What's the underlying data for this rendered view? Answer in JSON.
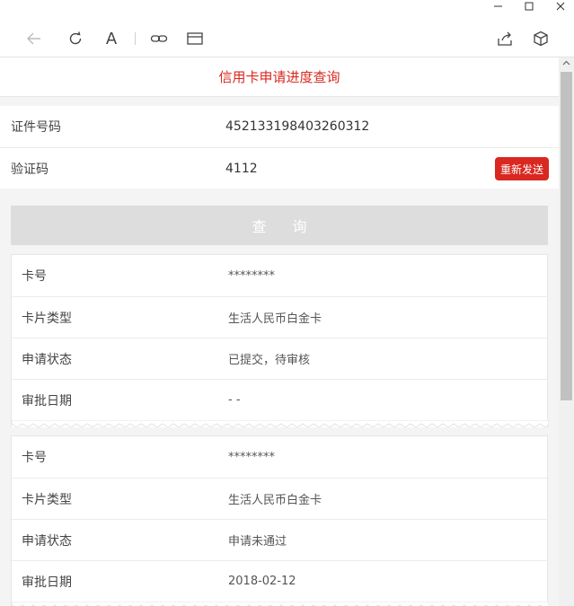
{
  "window": {
    "minimize_icon": "minimize-icon",
    "maximize_icon": "maximize-icon",
    "close_icon": "close-icon"
  },
  "toolbar": {
    "icons": [
      "back-arrow-icon",
      "refresh-icon",
      "font-a-icon",
      "link-icon",
      "card-view-icon",
      "share-icon",
      "package-icon"
    ],
    "font_label": "A"
  },
  "page": {
    "title": "信用卡申请进度查询"
  },
  "form": {
    "id_label": "证件号码",
    "id_value": "452133198403260312",
    "code_label": "验证码",
    "code_value": "4112",
    "resend_label": "重新发送"
  },
  "query_button": "查 询",
  "results": [
    {
      "card_no_label": "卡号",
      "card_no": "********",
      "card_type_label": "卡片类型",
      "card_type": "生活人民币白金卡",
      "status_label": "申请状态",
      "status": "已提交，待审核",
      "date_label": "审批日期",
      "date": "- -"
    },
    {
      "card_no_label": "卡号",
      "card_no": "********",
      "card_type_label": "卡片类型",
      "card_type": "生活人民币白金卡",
      "status_label": "申请状态",
      "status": "申请未通过",
      "date_label": "审批日期",
      "date": "2018-02-12"
    }
  ],
  "colors": {
    "accent": "#d9281f",
    "button_disabled": "#dddddd",
    "background": "#f4f4f4"
  }
}
